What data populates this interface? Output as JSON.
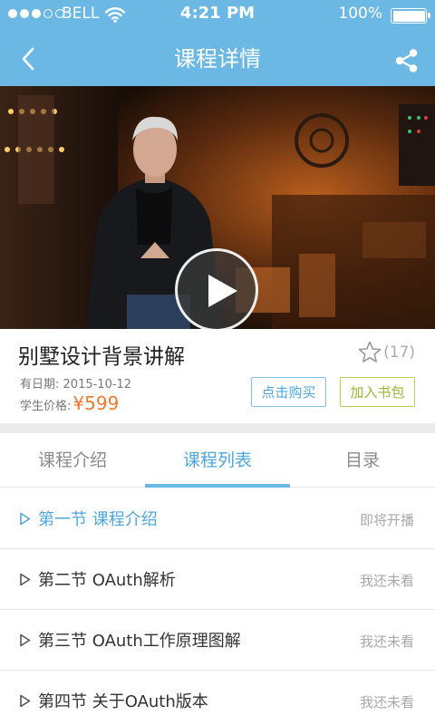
{
  "status_bar": {
    "carrier": "BELL",
    "time": "4:21 PM",
    "battery": "100%",
    "signal_bars_filled": 3,
    "signal_bars_total": 5,
    "battery_level": 1.0
  },
  "nav": {
    "title": "课程详情",
    "back_icon": "chevron-left-icon",
    "share_icon": "share-icon"
  },
  "video": {
    "play_icon": "play-icon"
  },
  "course": {
    "title": "别墅设计背景讲解",
    "rating_count": "(17)",
    "date_label": "有日期:",
    "date_value": "2015-10-12",
    "price_label": "学生价格:",
    "price_value": "¥599",
    "buy_label": "点击购买",
    "add_to_bag_label": "加入书包"
  },
  "tabs": [
    {
      "label": "课程介绍",
      "active": false
    },
    {
      "label": "课程列表",
      "active": true
    },
    {
      "label": "目录",
      "active": false
    }
  ],
  "lessons": [
    {
      "name": "第一节 课程介绍",
      "status": "即将开播",
      "active": true
    },
    {
      "name": "第二节 OAuth解析",
      "status": "我还未看",
      "active": false
    },
    {
      "name": "第三节 OAuth工作原理图解",
      "status": "我还未看",
      "active": false
    },
    {
      "name": "第四节 关于OAuth版本",
      "status": "我还未看",
      "active": false
    }
  ],
  "colors": {
    "primary": "#6cb8e4",
    "accent_blue": "#4ea7de",
    "price_orange": "#f07a2c",
    "bag_green": "#98b82e"
  }
}
